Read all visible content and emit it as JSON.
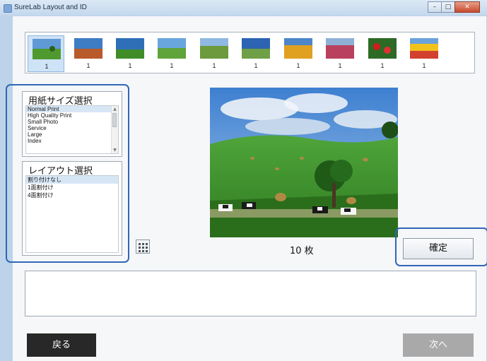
{
  "window": {
    "title": "SureLab Layout and ID",
    "app_icon": "app-icon",
    "controls": [
      "minimize-icon",
      "maximize-icon",
      "close-icon"
    ]
  },
  "thumbnails": [
    {
      "count": "1",
      "selected": true
    },
    {
      "count": "1"
    },
    {
      "count": "1"
    },
    {
      "count": "1"
    },
    {
      "count": "1"
    },
    {
      "count": "1"
    },
    {
      "count": "1"
    },
    {
      "count": "1"
    },
    {
      "count": "1"
    },
    {
      "count": "1"
    }
  ],
  "paper_panel": {
    "header": "用紙サイズ選択",
    "items": [
      "Normal Print",
      "High Quality Print",
      "Small Photo",
      "Service",
      "Large",
      "Index"
    ],
    "selected": "Normal Print"
  },
  "layout_panel": {
    "header": "レイアウト選択",
    "items": [
      "割り付けなし",
      "1面割付け",
      "4面割付け"
    ],
    "selected": "割り付けなし"
  },
  "layout_grid_button_icon": "layout-grid-icon",
  "preview": {
    "count_label": "10 枚"
  },
  "buttons": {
    "confirm": "確定",
    "back": "戻る",
    "next": "次へ"
  },
  "colors": {
    "highlight": "#2e68b6",
    "back_button": "#282828",
    "next_button_disabled": "#a9a9a9"
  }
}
